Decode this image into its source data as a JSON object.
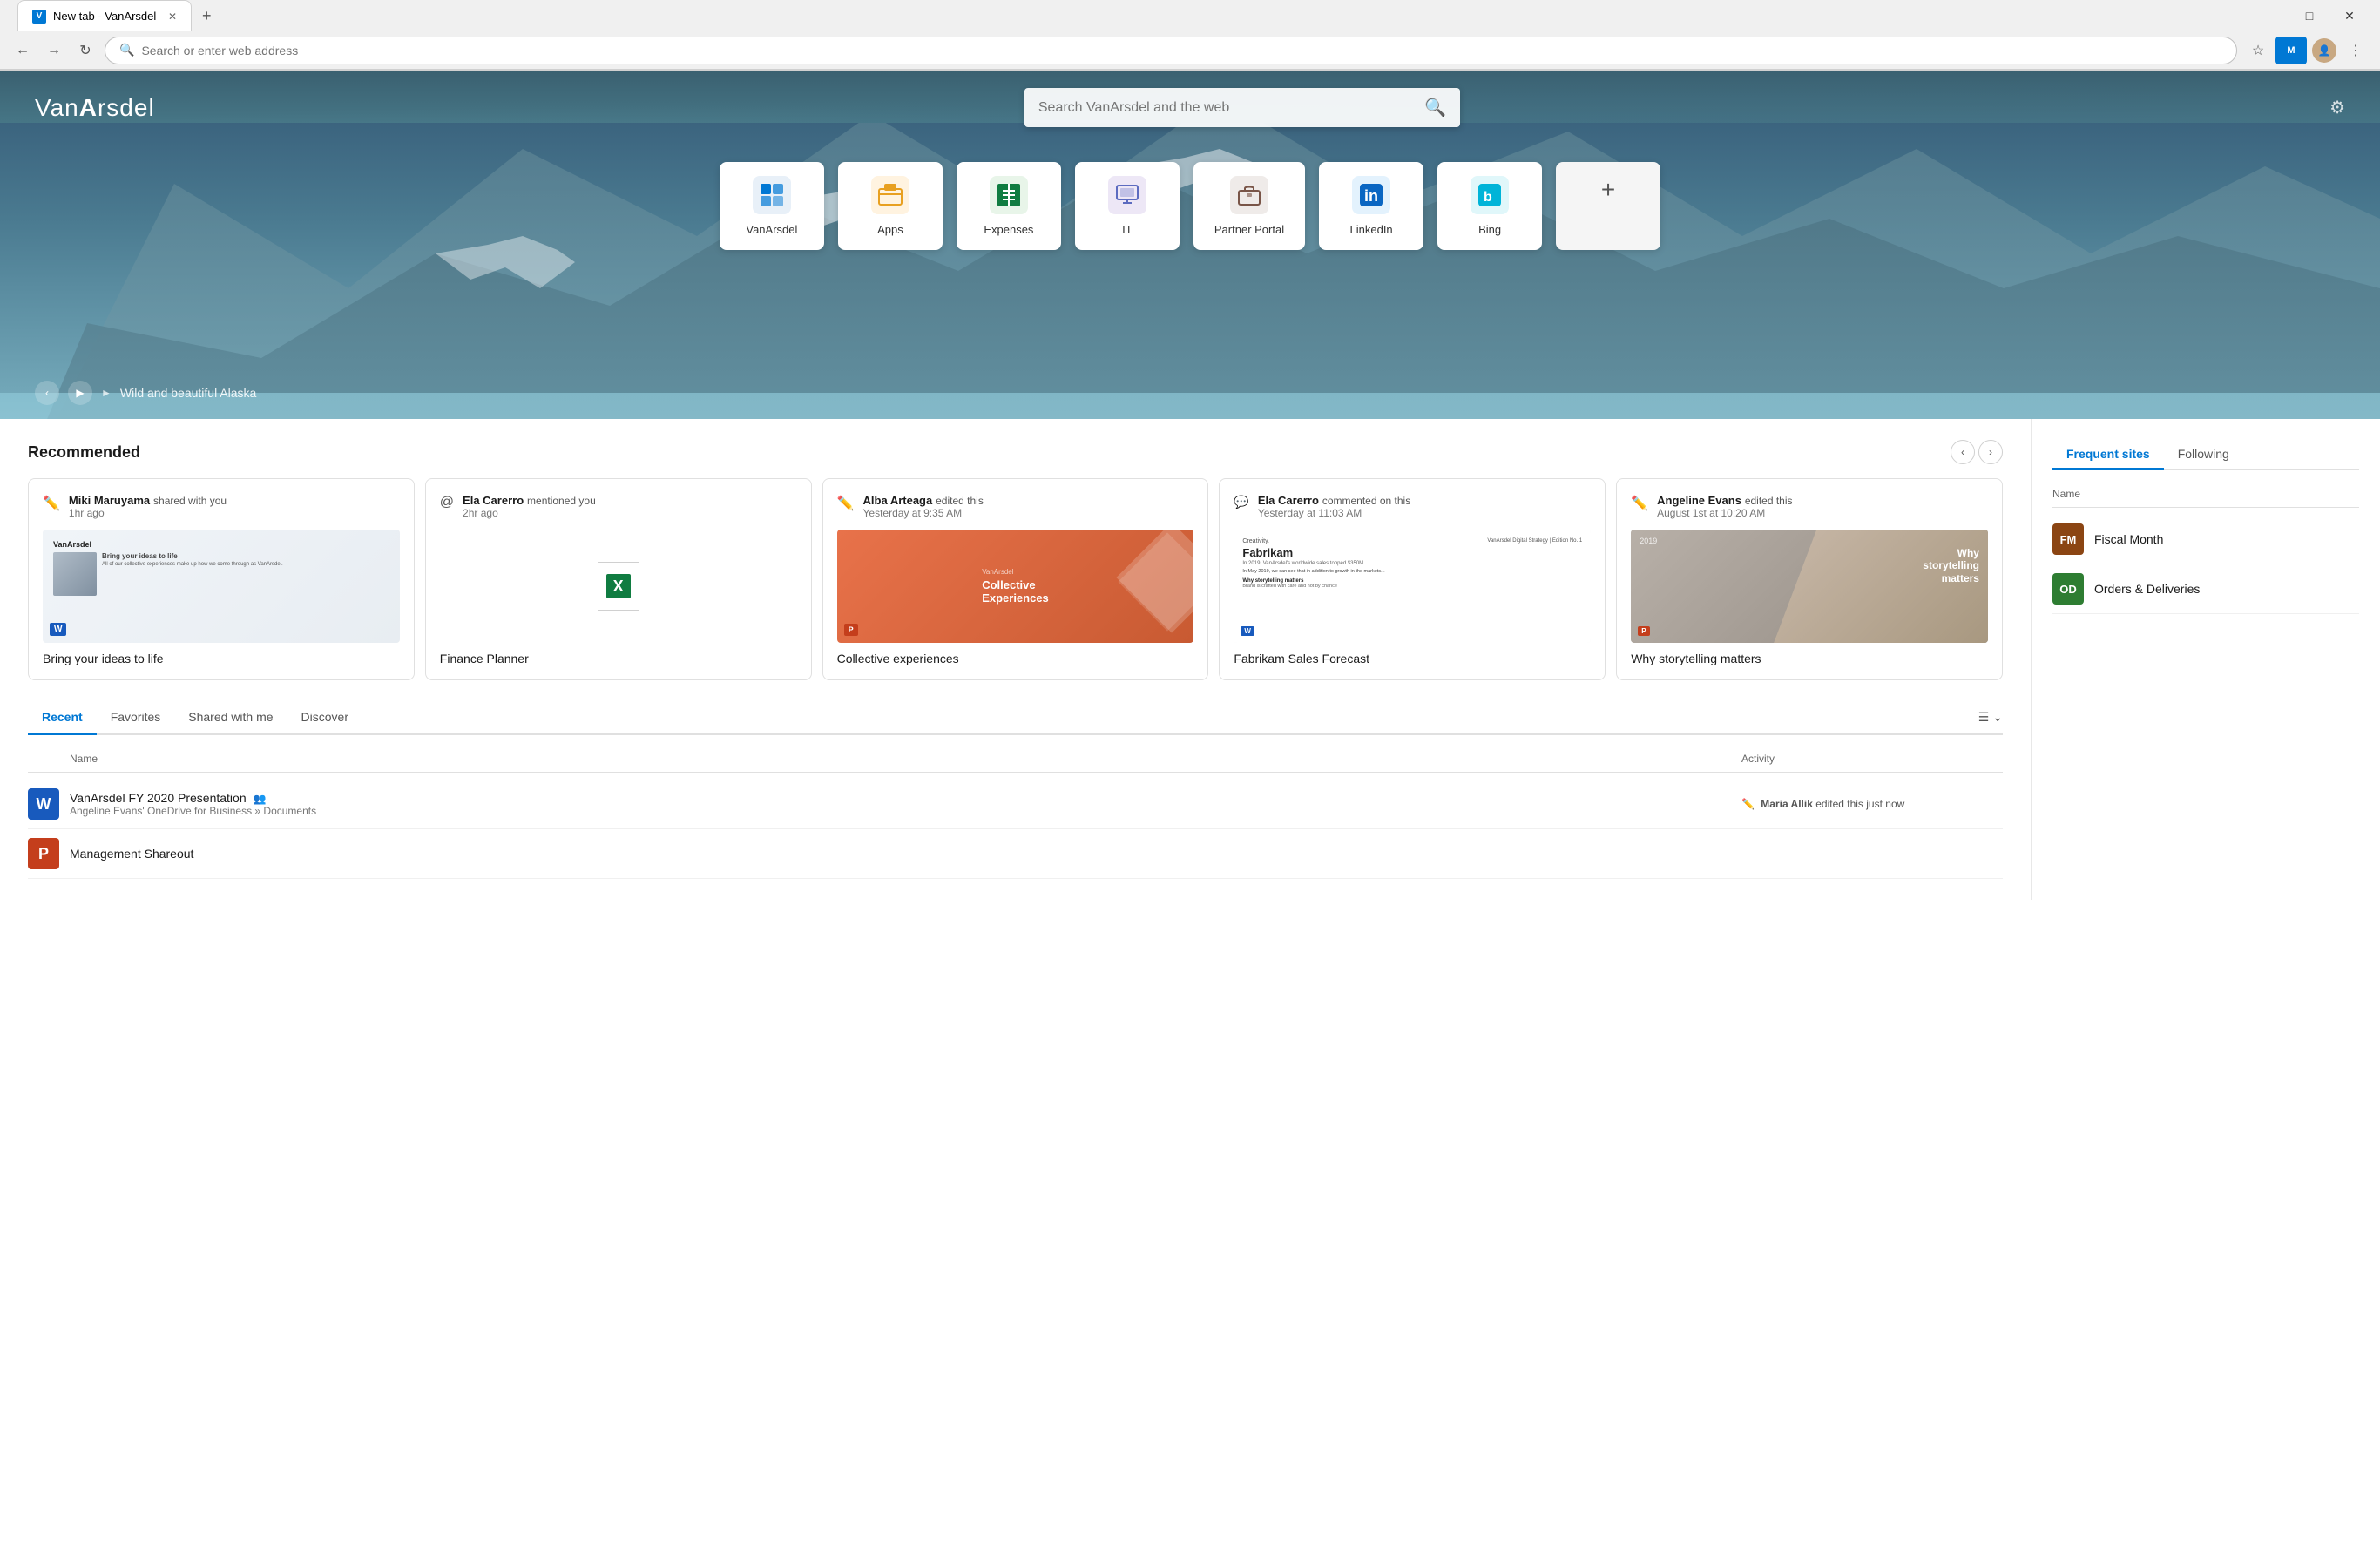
{
  "browser": {
    "tab_title": "New tab - VanArsdel",
    "address_placeholder": "Search or enter web address",
    "new_tab_btn": "+",
    "window_controls": {
      "minimize": "—",
      "maximize": "□",
      "close": "✕"
    }
  },
  "hero": {
    "brand": "VanArsdel",
    "search_placeholder": "Search VanArsdel and the web",
    "background_caption": "Wild and beautiful Alaska",
    "bg_provider": "b"
  },
  "quick_links": [
    {
      "id": "vanarsdel",
      "label": "VanArsdel",
      "color": "#0078d4",
      "icon": "grid",
      "bg": "#e8f0f8"
    },
    {
      "id": "apps",
      "label": "Apps",
      "color": "#e8a020",
      "icon": "apps",
      "bg": "#fff3e0"
    },
    {
      "id": "expenses",
      "label": "Expenses",
      "color": "#107c41",
      "icon": "table",
      "bg": "#e8f5e9"
    },
    {
      "id": "it",
      "label": "IT",
      "color": "#5c6bc0",
      "icon": "monitor",
      "bg": "#ede7f6"
    },
    {
      "id": "partner_portal",
      "label": "Partner Portal",
      "color": "#795548",
      "icon": "briefcase",
      "bg": "#efebe9"
    },
    {
      "id": "linkedin",
      "label": "LinkedIn",
      "color": "#0a66c2",
      "icon": "in",
      "bg": "#e3f2fd"
    },
    {
      "id": "bing",
      "label": "Bing",
      "color": "#00b4d8",
      "icon": "b",
      "bg": "#e0f7fa"
    },
    {
      "id": "add",
      "label": "+",
      "color": "#555",
      "icon": "+",
      "bg": "#f5f5f5"
    }
  ],
  "recommended": {
    "title": "Recommended",
    "cards": [
      {
        "id": "bring-your-ideas",
        "user": "Miki Maruyama",
        "action": "shared with you",
        "time": "1hr ago",
        "title": "Bring your ideas to life",
        "type": "word",
        "icon_color": "#0078d4"
      },
      {
        "id": "finance-planner",
        "user": "Ela Carerro",
        "action": "mentioned you",
        "time": "2hr ago",
        "title": "Finance Planner",
        "type": "excel",
        "icon_color": "#107c41"
      },
      {
        "id": "collective-experiences",
        "user": "Alba Arteaga",
        "action": "edited this",
        "time": "Yesterday at 9:35 AM",
        "title": "Collective experiences",
        "type": "ppt_orange",
        "icon_color": "#0078d4"
      },
      {
        "id": "fabrikam",
        "user": "Ela Carerro",
        "action": "commented on this",
        "time": "Yesterday at 11:03 AM",
        "title": "Fabrikam Sales Forecast",
        "type": "word_fabrikam",
        "icon_color": "#555"
      },
      {
        "id": "storytelling",
        "user": "Angeline Evans",
        "action": "edited this",
        "time": "August 1st at 10:20 AM",
        "title": "Why storytelling matters",
        "type": "ppt_storytelling",
        "icon_color": "#0078d4"
      }
    ]
  },
  "file_tabs": [
    "Recent",
    "Favorites",
    "Shared with me",
    "Discover"
  ],
  "active_file_tab": "Recent",
  "files": [
    {
      "id": "vanarsdel-fy",
      "name": "VanArsdel FY 2020 Presentation",
      "location": "Angeline Evans' OneDrive for Business » Documents",
      "activity_user": "Maria Allik",
      "activity_action": "edited this just now",
      "type": "word",
      "shared": true
    },
    {
      "id": "management-shareout",
      "name": "Management Shareout",
      "location": "",
      "activity_user": "",
      "activity_action": "",
      "type": "ppt"
    }
  ],
  "frequent_sites": {
    "tabs": [
      "Frequent sites",
      "Following"
    ],
    "active_tab": "Frequent sites",
    "header_label": "Name",
    "sites": [
      {
        "id": "fiscal-month",
        "label": "Fiscal Month",
        "abbr": "FM",
        "color": "#8b4513"
      },
      {
        "id": "orders-deliveries",
        "label": "Orders & Deliveries",
        "abbr": "OD",
        "color": "#2e7d32"
      }
    ]
  },
  "storytelling_year": "2019",
  "storytelling_why": "Why storytelling matters"
}
